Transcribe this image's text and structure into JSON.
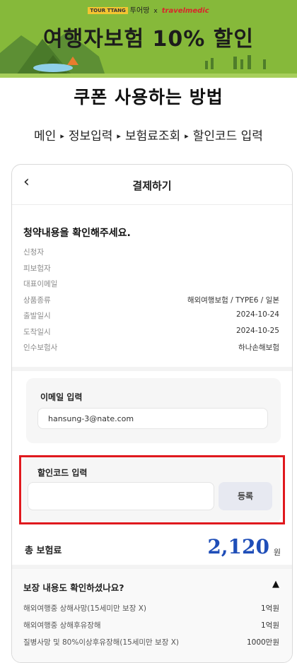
{
  "banner": {
    "brand_tourttang_badge": "TOUR TTANG",
    "brand_tourttang": "투어땅",
    "brand_x": "x",
    "brand_travelmedic": "travelmedic",
    "title": "여행자보험 10% 할인"
  },
  "heading": "쿠폰 사용하는 방법",
  "steps": [
    "메인",
    "정보입력",
    "보험료조회",
    "할인코드 입력"
  ],
  "step_arrow": "▸",
  "page": {
    "back_icon": "‹",
    "title": "결제하기"
  },
  "confirm_title": "청약내용을 확인해주세요.",
  "info_rows": [
    {
      "label": "신청자",
      "value": ""
    },
    {
      "label": "피보험자",
      "value": ""
    },
    {
      "label": "대표이메일",
      "value": ""
    },
    {
      "label": "상품종류",
      "value": "해외여행보험 / TYPE6 / 일본"
    },
    {
      "label": "출발일시",
      "value": "2024-10-24"
    },
    {
      "label": "도착일시",
      "value": "2024-10-25"
    },
    {
      "label": "인수보험사",
      "value": "하나손해보험"
    }
  ],
  "email": {
    "label": "이메일 입력",
    "value": "hansung-3@nate.com"
  },
  "code": {
    "label": "할인코드 입력",
    "value": "",
    "button": "등록"
  },
  "total": {
    "label": "총 보험료",
    "amount": "2,120",
    "unit": "원"
  },
  "coverage": {
    "question": "보장 내용도 확인하셨나요?",
    "toggle_icon": "▲",
    "rows": [
      {
        "label": "해외여행중 상해사망(15세미만 보장 X)",
        "value": "1억원"
      },
      {
        "label": "해외여행중 상해후유장해",
        "value": "1억원"
      },
      {
        "label": "질병사망 및 80%이상후유장해(15세미만 보장 X)",
        "value": "1000만원"
      }
    ]
  },
  "colors": {
    "banner_green": "#86b93a",
    "highlight_red": "#e0191e",
    "amount_blue": "#1f4eb8"
  }
}
